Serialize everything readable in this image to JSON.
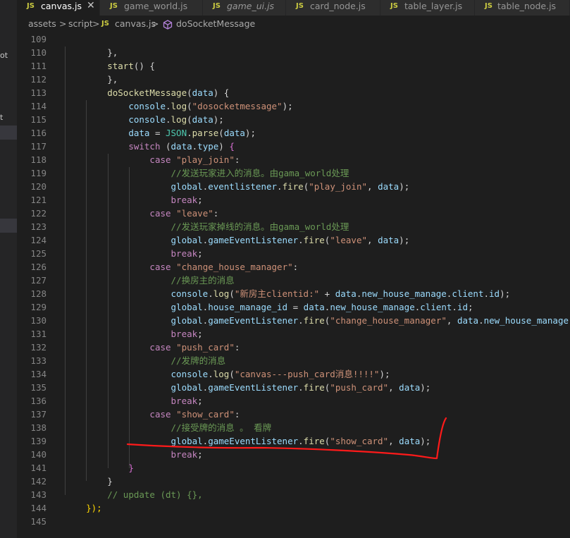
{
  "tabs": [
    {
      "label": "canvas.js",
      "badge": "JS",
      "active": true,
      "italic": false
    },
    {
      "label": "game_world.js",
      "badge": "JS",
      "active": false,
      "italic": false
    },
    {
      "label": "game_ui.js",
      "badge": "JS",
      "active": false,
      "italic": true
    },
    {
      "label": "card_node.js",
      "badge": "JS",
      "active": false,
      "italic": false
    },
    {
      "label": "table_layer.js",
      "badge": "JS",
      "active": false,
      "italic": false
    },
    {
      "label": "table_node.js",
      "badge": "JS",
      "active": false,
      "italic": false
    }
  ],
  "tab_close": "✕",
  "sidebar_fragments": [
    "ot",
    "t"
  ],
  "breadcrumb": {
    "part1": "assets",
    "part2": "script",
    "file_badge": "JS",
    "file": "canvas.js",
    "symbol": "doSocketMessage",
    "sep": ">"
  },
  "icons": {
    "symbol": "cube-method-icon",
    "close": "close-icon",
    "annotation": "red-underline-scribble"
  },
  "colors": {
    "keyword": "#c586c0",
    "function": "#dcdcaa",
    "string": "#ce9178",
    "variable": "#9cdcfe",
    "class": "#4ec9b0",
    "comment": "#6a9955",
    "annotation": "#ff1a1a"
  },
  "code_lines": [
    {
      "n": "109",
      "tokens": []
    },
    {
      "n": "110",
      "tokens": [
        [
          "pl",
          "        },"
        ]
      ]
    },
    {
      "n": "111",
      "tokens": [
        [
          "pl",
          "        "
        ],
        [
          "fn",
          "start"
        ],
        [
          "pl",
          "() {"
        ]
      ]
    },
    {
      "n": "112",
      "tokens": [
        [
          "pl",
          "        },"
        ]
      ]
    },
    {
      "n": "113",
      "tokens": [
        [
          "pl",
          "        "
        ],
        [
          "fn",
          "doSocketMessage"
        ],
        [
          "pl",
          "("
        ],
        [
          "var",
          "data"
        ],
        [
          "pl",
          ") {"
        ]
      ]
    },
    {
      "n": "114",
      "tokens": [
        [
          "pl",
          "            "
        ],
        [
          "var",
          "console"
        ],
        [
          "pl",
          "."
        ],
        [
          "fn",
          "log"
        ],
        [
          "pl",
          "("
        ],
        [
          "str",
          "\"dosocketmessage\""
        ],
        [
          "pl",
          ");"
        ]
      ]
    },
    {
      "n": "115",
      "tokens": [
        [
          "pl",
          "            "
        ],
        [
          "var",
          "console"
        ],
        [
          "pl",
          "."
        ],
        [
          "fn",
          "log"
        ],
        [
          "pl",
          "("
        ],
        [
          "var",
          "data"
        ],
        [
          "pl",
          ");"
        ]
      ]
    },
    {
      "n": "116",
      "tokens": [
        [
          "pl",
          "            "
        ],
        [
          "var",
          "data"
        ],
        [
          "pl",
          " = "
        ],
        [
          "cls",
          "JSON"
        ],
        [
          "pl",
          "."
        ],
        [
          "fn",
          "parse"
        ],
        [
          "pl",
          "("
        ],
        [
          "var",
          "data"
        ],
        [
          "pl",
          ");"
        ]
      ]
    },
    {
      "n": "117",
      "tokens": [
        [
          "pl",
          "            "
        ],
        [
          "kw",
          "switch"
        ],
        [
          "pl",
          " ("
        ],
        [
          "var",
          "data"
        ],
        [
          "pl",
          "."
        ],
        [
          "var",
          "type"
        ],
        [
          "pl",
          ") "
        ],
        [
          "br",
          "{"
        ]
      ]
    },
    {
      "n": "118",
      "tokens": [
        [
          "pl",
          "                "
        ],
        [
          "kw",
          "case"
        ],
        [
          "pl",
          " "
        ],
        [
          "str",
          "\"play_join\""
        ],
        [
          "pl",
          ":"
        ]
      ]
    },
    {
      "n": "119",
      "tokens": [
        [
          "pl",
          "                    "
        ],
        [
          "cm",
          "//发送玩家进入的消息。由gama_world处理"
        ]
      ]
    },
    {
      "n": "120",
      "tokens": [
        [
          "pl",
          "                    "
        ],
        [
          "var",
          "global"
        ],
        [
          "pl",
          "."
        ],
        [
          "var",
          "eventlistener"
        ],
        [
          "pl",
          "."
        ],
        [
          "fn",
          "fire"
        ],
        [
          "pl",
          "("
        ],
        [
          "str",
          "\"play_join\""
        ],
        [
          "pl",
          ", "
        ],
        [
          "var",
          "data"
        ],
        [
          "pl",
          ");"
        ]
      ]
    },
    {
      "n": "121",
      "tokens": [
        [
          "pl",
          "                    "
        ],
        [
          "kw",
          "break"
        ],
        [
          "pl",
          ";"
        ]
      ]
    },
    {
      "n": "122",
      "tokens": [
        [
          "pl",
          "                "
        ],
        [
          "kw",
          "case"
        ],
        [
          "pl",
          " "
        ],
        [
          "str",
          "\"leave\""
        ],
        [
          "pl",
          ":"
        ]
      ]
    },
    {
      "n": "123",
      "tokens": [
        [
          "pl",
          "                    "
        ],
        [
          "cm",
          "//发送玩家掉线的消息。由gama_world处理"
        ]
      ]
    },
    {
      "n": "124",
      "tokens": [
        [
          "pl",
          "                    "
        ],
        [
          "var",
          "global"
        ],
        [
          "pl",
          "."
        ],
        [
          "var",
          "gameEventListener"
        ],
        [
          "pl",
          "."
        ],
        [
          "fn",
          "fire"
        ],
        [
          "pl",
          "("
        ],
        [
          "str",
          "\"leave\""
        ],
        [
          "pl",
          ", "
        ],
        [
          "var",
          "data"
        ],
        [
          "pl",
          ");"
        ]
      ]
    },
    {
      "n": "125",
      "tokens": [
        [
          "pl",
          "                    "
        ],
        [
          "kw",
          "break"
        ],
        [
          "pl",
          ";"
        ]
      ]
    },
    {
      "n": "126",
      "tokens": [
        [
          "pl",
          "                "
        ],
        [
          "kw",
          "case"
        ],
        [
          "pl",
          " "
        ],
        [
          "str",
          "\"change_house_manager\""
        ],
        [
          "pl",
          ":"
        ]
      ]
    },
    {
      "n": "127",
      "tokens": [
        [
          "pl",
          "                    "
        ],
        [
          "cm",
          "//换房主的消息"
        ]
      ]
    },
    {
      "n": "128",
      "tokens": [
        [
          "pl",
          "                    "
        ],
        [
          "var",
          "console"
        ],
        [
          "pl",
          "."
        ],
        [
          "fn",
          "log"
        ],
        [
          "pl",
          "("
        ],
        [
          "str",
          "\"新房主clientid:\""
        ],
        [
          "pl",
          " + "
        ],
        [
          "var",
          "data"
        ],
        [
          "pl",
          "."
        ],
        [
          "var",
          "new_house_manage"
        ],
        [
          "pl",
          "."
        ],
        [
          "var",
          "client"
        ],
        [
          "pl",
          "."
        ],
        [
          "var",
          "id"
        ],
        [
          "pl",
          ");"
        ]
      ]
    },
    {
      "n": "129",
      "tokens": [
        [
          "pl",
          "                    "
        ],
        [
          "var",
          "global"
        ],
        [
          "pl",
          "."
        ],
        [
          "var",
          "house_manage_id"
        ],
        [
          "pl",
          " = "
        ],
        [
          "var",
          "data"
        ],
        [
          "pl",
          "."
        ],
        [
          "var",
          "new_house_manage"
        ],
        [
          "pl",
          "."
        ],
        [
          "var",
          "client"
        ],
        [
          "pl",
          "."
        ],
        [
          "var",
          "id"
        ],
        [
          "pl",
          ";"
        ]
      ]
    },
    {
      "n": "130",
      "tokens": [
        [
          "pl",
          "                    "
        ],
        [
          "var",
          "global"
        ],
        [
          "pl",
          "."
        ],
        [
          "var",
          "gameEventListener"
        ],
        [
          "pl",
          "."
        ],
        [
          "fn",
          "fire"
        ],
        [
          "pl",
          "("
        ],
        [
          "str",
          "\"change_house_manager\""
        ],
        [
          "pl",
          ", "
        ],
        [
          "var",
          "data"
        ],
        [
          "pl",
          "."
        ],
        [
          "var",
          "new_house_manage"
        ],
        [
          "pl",
          "."
        ],
        [
          "var",
          "c"
        ]
      ]
    },
    {
      "n": "131",
      "tokens": [
        [
          "pl",
          "                    "
        ],
        [
          "kw",
          "break"
        ],
        [
          "pl",
          ";"
        ]
      ]
    },
    {
      "n": "132",
      "tokens": [
        [
          "pl",
          "                "
        ],
        [
          "kw",
          "case"
        ],
        [
          "pl",
          " "
        ],
        [
          "str",
          "\"push_card\""
        ],
        [
          "pl",
          ":"
        ]
      ]
    },
    {
      "n": "133",
      "tokens": [
        [
          "pl",
          "                    "
        ],
        [
          "cm",
          "//发牌的消息"
        ]
      ]
    },
    {
      "n": "134",
      "tokens": [
        [
          "pl",
          "                    "
        ],
        [
          "var",
          "console"
        ],
        [
          "pl",
          "."
        ],
        [
          "fn",
          "log"
        ],
        [
          "pl",
          "("
        ],
        [
          "str",
          "\"canvas---push_card消息!!!!\""
        ],
        [
          "pl",
          ");"
        ]
      ]
    },
    {
      "n": "135",
      "tokens": [
        [
          "pl",
          "                    "
        ],
        [
          "var",
          "global"
        ],
        [
          "pl",
          "."
        ],
        [
          "var",
          "gameEventListener"
        ],
        [
          "pl",
          "."
        ],
        [
          "fn",
          "fire"
        ],
        [
          "pl",
          "("
        ],
        [
          "str",
          "\"push_card\""
        ],
        [
          "pl",
          ", "
        ],
        [
          "var",
          "data"
        ],
        [
          "pl",
          ");"
        ]
      ]
    },
    {
      "n": "136",
      "tokens": [
        [
          "pl",
          "                    "
        ],
        [
          "kw",
          "break"
        ],
        [
          "pl",
          ";"
        ]
      ]
    },
    {
      "n": "137",
      "tokens": [
        [
          "pl",
          "                "
        ],
        [
          "kw",
          "case"
        ],
        [
          "pl",
          " "
        ],
        [
          "str",
          "\"show_card\""
        ],
        [
          "pl",
          ":"
        ]
      ]
    },
    {
      "n": "138",
      "tokens": [
        [
          "pl",
          "                    "
        ],
        [
          "cm",
          "//接受牌的消息 。 看牌"
        ]
      ]
    },
    {
      "n": "139",
      "tokens": [
        [
          "pl",
          "                    "
        ],
        [
          "var",
          "global"
        ],
        [
          "pl",
          "."
        ],
        [
          "var",
          "gameEventListener"
        ],
        [
          "pl",
          "."
        ],
        [
          "fn",
          "fire"
        ],
        [
          "pl",
          "("
        ],
        [
          "str",
          "\"show_card\""
        ],
        [
          "pl",
          ", "
        ],
        [
          "var",
          "data"
        ],
        [
          "pl",
          ");"
        ]
      ]
    },
    {
      "n": "140",
      "tokens": [
        [
          "pl",
          "                    "
        ],
        [
          "kw",
          "break"
        ],
        [
          "pl",
          ";"
        ]
      ]
    },
    {
      "n": "141",
      "tokens": [
        [
          "pl",
          "            "
        ],
        [
          "br",
          "}"
        ]
      ]
    },
    {
      "n": "142",
      "tokens": [
        [
          "pl",
          "        }"
        ]
      ]
    },
    {
      "n": "143",
      "tokens": [
        [
          "pl",
          "        "
        ],
        [
          "cm",
          "// update (dt) {},"
        ]
      ]
    },
    {
      "n": "144",
      "tokens": [
        [
          "pl",
          "    "
        ],
        [
          "br2",
          "});"
        ]
      ]
    },
    {
      "n": "145",
      "tokens": []
    }
  ]
}
